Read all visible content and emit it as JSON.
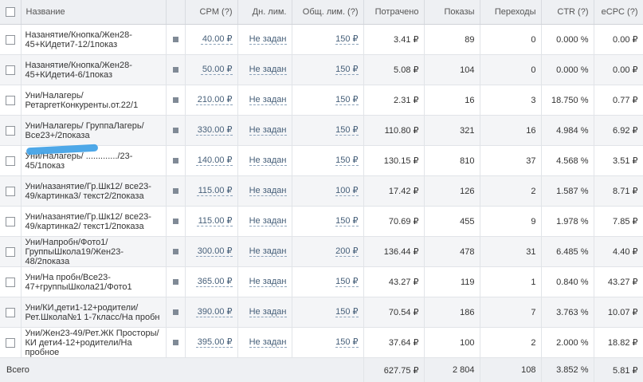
{
  "table": {
    "headers": {
      "name": "Название",
      "cpm": "CPM (?)",
      "daily_limit": "Дн. лим.",
      "total_limit": "Общ. лим. (?)",
      "spent": "Потрачено",
      "impressions": "Показы",
      "clicks": "Переходы",
      "ctr": "CTR (?)",
      "ecpc": "eCPC (?)"
    },
    "rows": [
      {
        "name": "Назанятие/Кнопка/Жен28-45+КИдети7-12/1показ",
        "cpm": "40.00 ₽",
        "daily": "Не задан",
        "total": "150 ₽",
        "spent": "3.41 ₽",
        "impressions": "89",
        "clicks": "0",
        "ctr": "0.000 %",
        "ecpc": "0.00 ₽"
      },
      {
        "name": "Назанятие/Кнопка/Жен28-45+КИдети4-6/1показ",
        "cpm": "50.00 ₽",
        "daily": "Не задан",
        "total": "150 ₽",
        "spent": "5.08 ₽",
        "impressions": "104",
        "clicks": "0",
        "ctr": "0.000 %",
        "ecpc": "0.00 ₽"
      },
      {
        "name": "Уни/Налагерь/ РетаргетКонкуренты.от.22/1",
        "cpm": "210.00 ₽",
        "daily": "Не задан",
        "total": "150 ₽",
        "spent": "2.31 ₽",
        "impressions": "16",
        "clicks": "3",
        "ctr": "18.750 %",
        "ecpc": "0.77 ₽"
      },
      {
        "name": "Уни/Налагерь/ ГруппаЛагерь/ Все23+/2показа",
        "cpm": "330.00 ₽",
        "daily": "Не задан",
        "total": "150 ₽",
        "spent": "110.80 ₽",
        "impressions": "321",
        "clicks": "16",
        "ctr": "4.984 %",
        "ecpc": "6.92 ₽"
      },
      {
        "name": "Уни/Налагерь/ ............./23-45/1показ",
        "cpm": "140.00 ₽",
        "daily": "Не задан",
        "total": "150 ₽",
        "spent": "130.15 ₽",
        "impressions": "810",
        "clicks": "37",
        "ctr": "4.568 %",
        "ecpc": "3.51 ₽"
      },
      {
        "name": "Уни/назанятие/Гр.Шк12/ все23-49/картинка3/ текст2/2показа",
        "cpm": "115.00 ₽",
        "daily": "Не задан",
        "total": "100 ₽",
        "spent": "17.42 ₽",
        "impressions": "126",
        "clicks": "2",
        "ctr": "1.587 %",
        "ecpc": "8.71 ₽"
      },
      {
        "name": "Уни/назанятие/Гр.Шк12/ все23-49/картинка2/ текст1/2показа",
        "cpm": "115.00 ₽",
        "daily": "Не задан",
        "total": "150 ₽",
        "spent": "70.69 ₽",
        "impressions": "455",
        "clicks": "9",
        "ctr": "1.978 %",
        "ecpc": "7.85 ₽"
      },
      {
        "name": "Уни/Напробн/Фото1/ ГруппыШкола19/Жен23-48/2показа",
        "cpm": "300.00 ₽",
        "daily": "Не задан",
        "total": "200 ₽",
        "spent": "136.44 ₽",
        "impressions": "478",
        "clicks": "31",
        "ctr": "6.485 %",
        "ecpc": "4.40 ₽"
      },
      {
        "name": "Уни/На пробн/Все23-47+группыШкола21/Фото1",
        "cpm": "365.00 ₽",
        "daily": "Не задан",
        "total": "150 ₽",
        "spent": "43.27 ₽",
        "impressions": "119",
        "clicks": "1",
        "ctr": "0.840 %",
        "ecpc": "43.27 ₽"
      },
      {
        "name": "Уни/КИ,дети1-12+родители/ Рет.Школа№1 1-7класс/На пробн",
        "cpm": "390.00 ₽",
        "daily": "Не задан",
        "total": "150 ₽",
        "spent": "70.54 ₽",
        "impressions": "186",
        "clicks": "7",
        "ctr": "3.763 %",
        "ecpc": "10.07 ₽"
      },
      {
        "name": "Уни/Жен23-49/Рет.ЖК Просторы/КИ дети4-12+родители/На пробное",
        "cpm": "395.00 ₽",
        "daily": "Не задан",
        "total": "150 ₽",
        "spent": "37.64 ₽",
        "impressions": "100",
        "clicks": "2",
        "ctr": "2.000 %",
        "ecpc": "18.82 ₽"
      }
    ],
    "totals": {
      "label": "Всего",
      "spent": "627.75 ₽",
      "impressions": "2 804",
      "clicks": "108",
      "ctr": "3.852 %",
      "ecpc": "5.81 ₽"
    }
  },
  "colors": {
    "header_bg": "#eef0f3",
    "row_alt_bg": "#f4f5f7",
    "link": "#47607a",
    "redaction": "#3b9ee6"
  }
}
